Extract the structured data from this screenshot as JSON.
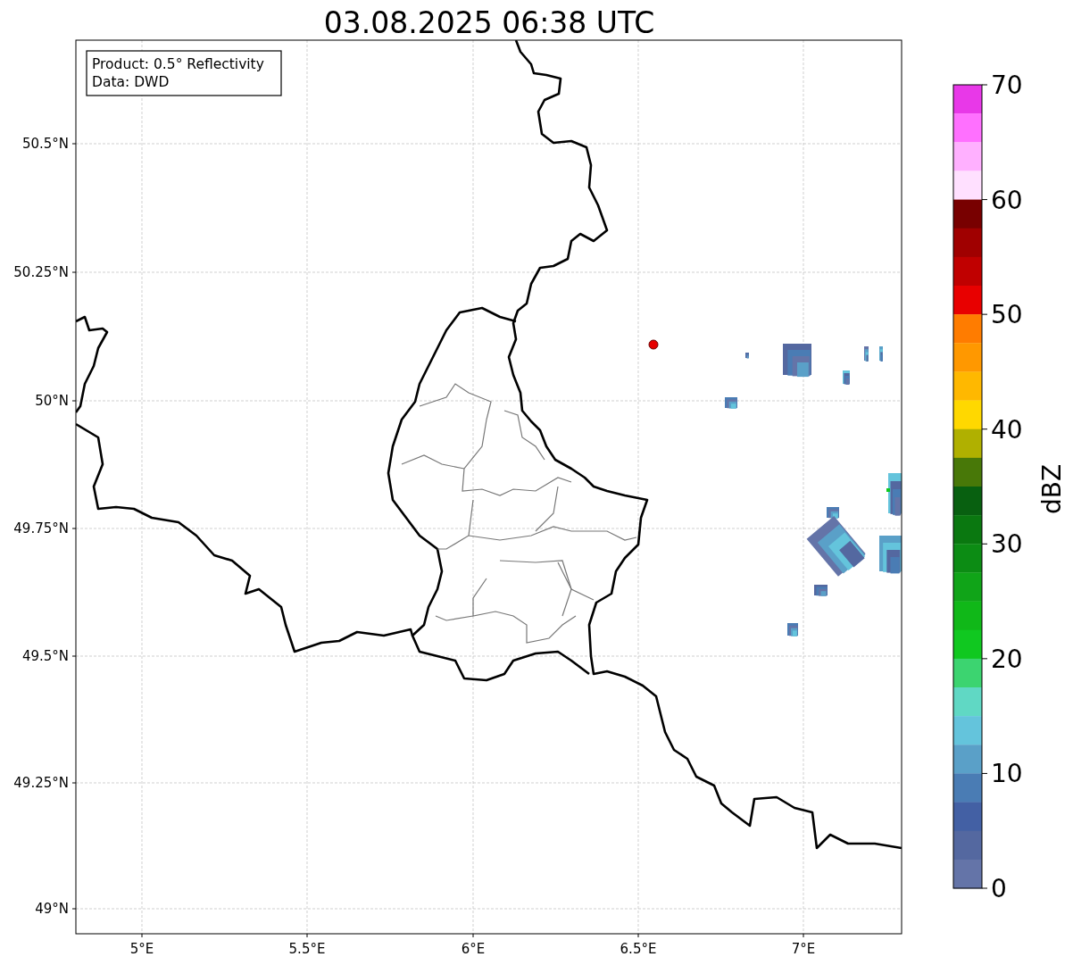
{
  "title": "03.08.2025 06:38 UTC",
  "legend": [
    "Product: 0.5° Reflectivity",
    "Data: DWD"
  ],
  "lat_labels": [
    "50.5°N",
    "50.25°N",
    "50°N",
    "49.75°N",
    "49.5°N",
    "49.25°N",
    "49°N"
  ],
  "lon_labels": [
    "5°E",
    "5.5°E",
    "6°E",
    "6.5°E",
    "7°E"
  ],
  "colorbar": {
    "label": "dBZ",
    "ticks": [
      "70",
      "60",
      "50",
      "40",
      "30",
      "20",
      "10",
      "0"
    ],
    "colors": [
      {
        "color": "#e838e8"
      },
      {
        "color": "#ff70ff"
      },
      {
        "color": "#ffb0ff"
      },
      {
        "color": "#ffe0ff"
      },
      {
        "color": "#780000"
      },
      {
        "color": "#a00000"
      },
      {
        "color": "#c00000"
      },
      {
        "color": "#e80000"
      },
      {
        "color": "#ff7c00"
      },
      {
        "color": "#ff9800"
      },
      {
        "color": "#ffb800"
      },
      {
        "color": "#ffd800"
      },
      {
        "color": "#b0b000"
      },
      {
        "color": "#487808"
      },
      {
        "color": "#086010"
      },
      {
        "color": "#0a7810"
      },
      {
        "color": "#0c8c14"
      },
      {
        "color": "#10a418"
      },
      {
        "color": "#10b818"
      },
      {
        "color": "#10c820"
      },
      {
        "color": "#3cd470"
      },
      {
        "color": "#60d8c4"
      },
      {
        "color": "#64c4dc"
      },
      {
        "color": "#5aa0c8"
      },
      {
        "color": "#4a7cb4"
      },
      {
        "color": "#4360a4"
      },
      {
        "color": "#5468a0"
      },
      {
        "color": "#6474a8"
      }
    ]
  }
}
